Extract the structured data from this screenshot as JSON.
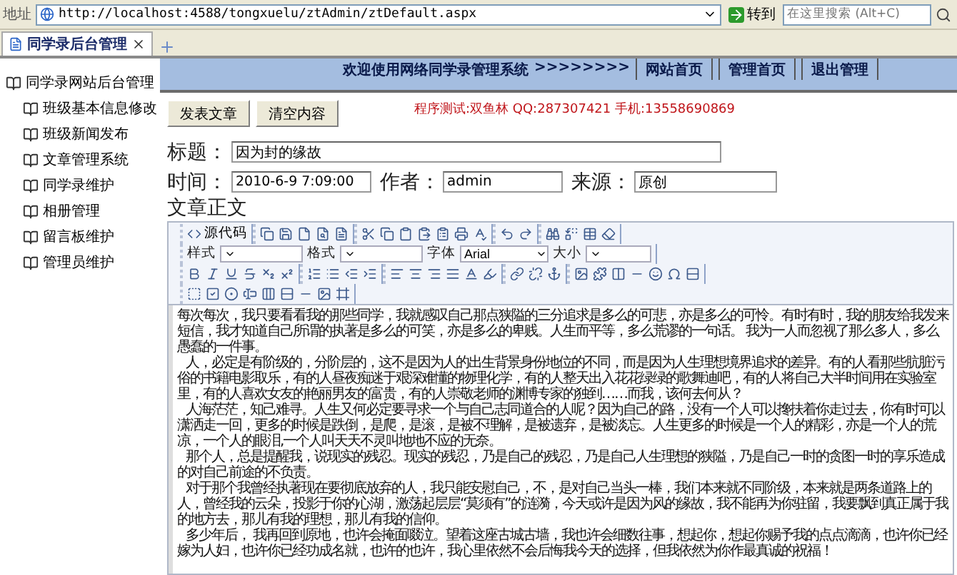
{
  "address_bar": {
    "label": "地址",
    "url": "http://localhost:4588/tongxuelu/ztAdmin/ztDefault.aspx",
    "go": "转到",
    "search_placeholder": "在这里搜索 (Alt+C)"
  },
  "tabs": [
    {
      "label": "同学录后台管理",
      "selected": true
    }
  ],
  "sidebar": {
    "title": "同学录网站后台管理",
    "items": [
      "班级基本信息修改",
      "班级新闻发布",
      "文章管理系统",
      "同学录维护",
      "相册管理",
      "留言板维护",
      "管理员维护"
    ]
  },
  "header": {
    "welcome": "欢迎使用网络同学录管理系统",
    "arrows": ">>>>>>>>",
    "links": [
      "网站首页",
      "管理首页",
      "退出管理"
    ]
  },
  "buttons": [
    "发表文章",
    "清空内容"
  ],
  "notice": "程序测试:双鱼林 QQ:287307421 手机:13558690869",
  "form": {
    "title_label": "标题：",
    "title": "因为封的缘故",
    "time_label": "时间：",
    "time": "2010-6-9 7:09:00",
    "author_label": "作者：",
    "author": "admin",
    "source_label": "来源：",
    "source": "原创",
    "body_label": "文章正文"
  },
  "editor": {
    "source_button": "源代码",
    "style_label": "样式",
    "format_label": "格式",
    "font_label": "字体",
    "font": "Arial",
    "size_label": "大小",
    "paragraphs": [
      "每次每次，我只要看看我的那些同学，我就感叹自己那点狭隘的三分追求是多么的可悲，亦是多么的可怜。有时有时，我的朋友给我发来短信，我才知道自己所谓的执著是多么的可笑，亦是多么的卑贱。人生而平等，多么荒谬的一句话。 我为一人而忽视了那么多人，多么愚蠢的一件事。",
      "人，必定是有阶级的，分阶层的，这不是因为人的出生背景身份地位的不同，而是因为人生理想境界追求的差异。有的人看那些肮脏污俗的书籍电影取乐，有的人昼夜痴迷于艰深难懂的物理化学，有的人整天出入花花绿绿的歌舞迪吧，有的人将自己大半时间用在实验室里，有的人喜欢女友的艳丽男友的富贵，有的人崇敬老师的渊博专家的独到……而我，该何去何从？",
      "人海茫茫，知己难寻。人生又何必定要寻求一个与自己志同道合的人呢？因为自己的路，没有一个人可以搀扶着你走过去，你有时可以潇洒走一回，更多的时候是跌倒，是爬，是滚，是被不理解，是被遗弃，是被淡忘。人生更多的时候是一个人的精彩，亦是一个人的荒凉，一个人的眼泪,一个人叫天天不灵叫地地不应的无奈。",
      "那个人，总是提醒我，说现实的残忍。现实的残忍，乃是自己的残忍，乃是自己人生理想的狭隘，乃是自己一时的贪图一时的享乐造成的对自己前途的不负责。",
      "对于那个我曾经执著现在要彻底放弃的人，我只能安慰自己，不，是对自己当头一棒，我们本来就不同阶级，本来就是两条道路上的人，曾经我的云朵，投影于你的心湖，激荡起层层“莫须有”的涟漪，今天或许是因为风的缘故，我不能再为你驻留，我要飘到真正属于我的地方去，那儿有我的理想，那儿有我的信仰。",
      "多少年后， 我再回到原地，也许会掩面啜泣。望着这座古城古墙，我也许会细数往事，想起你，想起你赐予我的点点滴滴，也许你已经嫁为人妇，也许你已经功成名就，也许的也许，我心里依然不会后悔我今天的选择，但我依然为你作最真诚的祝福！"
    ]
  }
}
